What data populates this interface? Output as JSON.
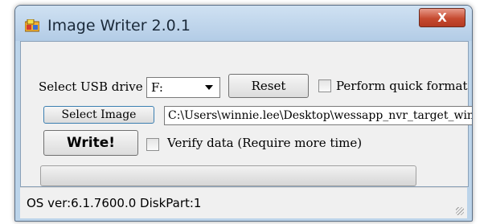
{
  "window": {
    "title": "Image Writer 2.0.1",
    "close_glyph": "X"
  },
  "usb": {
    "label": "Select USB drive",
    "selected_drive": "F:"
  },
  "buttons": {
    "reset": "Reset",
    "select_image": "Select Image",
    "write": "Write!"
  },
  "options": {
    "quick_format": {
      "label": "Perform quick format",
      "checked": false
    },
    "verify": {
      "label": "Verify data (Require more time)",
      "checked": false
    }
  },
  "image_path": "C:\\Users\\winnie.lee\\Desktop\\wessapp_nvr_target_window",
  "progress": {
    "value": 0
  },
  "status_bar": {
    "text": "OS ver:6.1.7600.0 DiskPart:1"
  },
  "colors": {
    "title_bar": "#bcd4ea",
    "close_button": "#c64a30",
    "client_bg": "#f0f0f0"
  }
}
